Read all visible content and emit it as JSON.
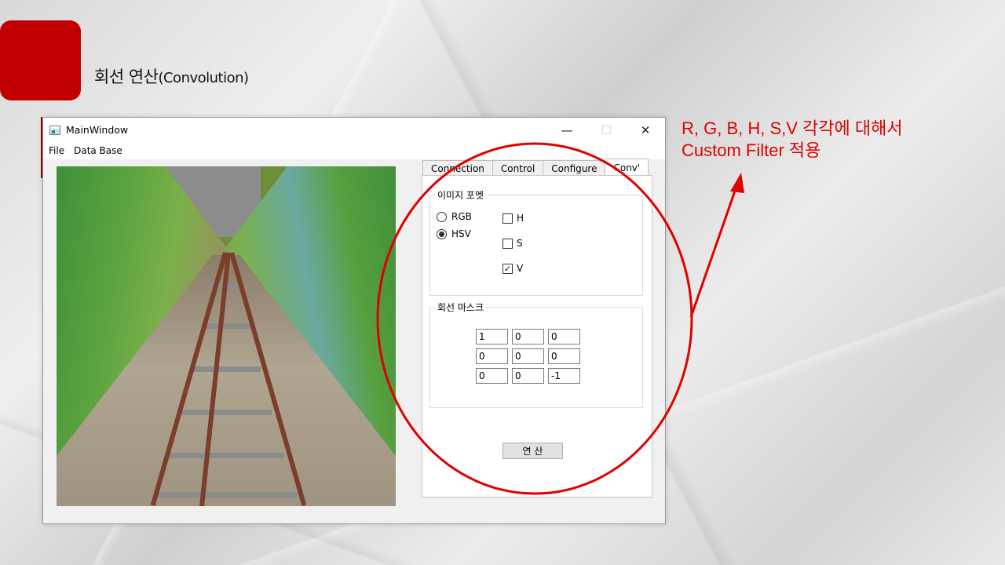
{
  "slide": {
    "title_ko": "회선 연산",
    "title_en": "(Convolution)"
  },
  "window": {
    "title": "MainWindow",
    "controls": {
      "minimize": "—",
      "maximize": "☐",
      "close": "✕"
    },
    "menu": [
      "File",
      "Data Base"
    ]
  },
  "tabs": [
    "Connection",
    "Control",
    "Configure",
    "Conv'"
  ],
  "active_tab": "Conv'",
  "image_format": {
    "group_title": "이미지 포멧",
    "radios": [
      {
        "label": "RGB",
        "checked": false
      },
      {
        "label": "HSV",
        "checked": true
      }
    ],
    "checks": [
      {
        "label": "H",
        "checked": false
      },
      {
        "label": "S",
        "checked": false
      },
      {
        "label": "V",
        "checked": true
      }
    ]
  },
  "mask": {
    "group_title": "회선 마스크",
    "values": [
      [
        "1",
        "0",
        "0"
      ],
      [
        "0",
        "0",
        "0"
      ],
      [
        "0",
        "0",
        "-1"
      ]
    ]
  },
  "calc_button": "연 산",
  "annotation": {
    "line1": "R, G, B, H, S,V 각각에 대해서",
    "line2": "Custom Filter 적용",
    "color": "#e00000"
  }
}
